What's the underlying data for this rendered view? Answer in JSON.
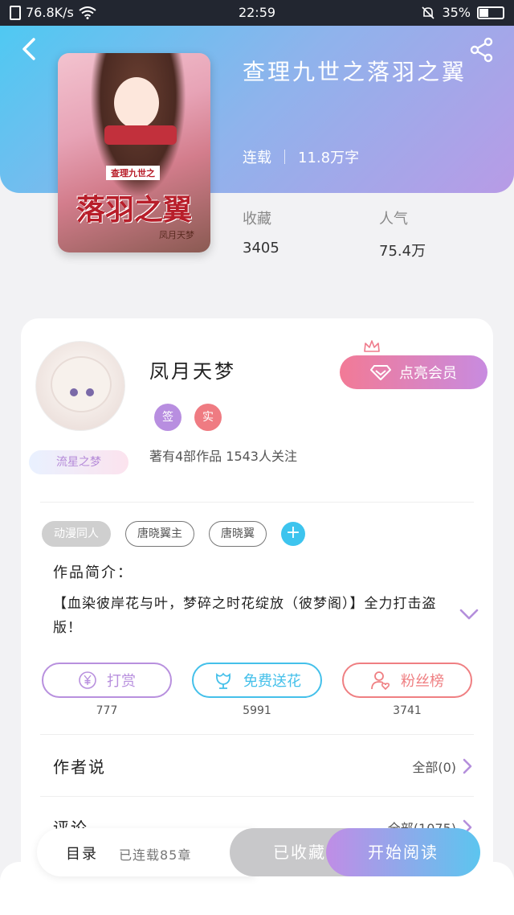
{
  "status_bar": {
    "speed": "76.8K/s",
    "time": "22:59",
    "battery": "35%",
    "battery_level": 0.35
  },
  "book": {
    "title": "查理九世之落羽之翼",
    "status": "连载",
    "word_count": "11.8万字",
    "stats": [
      {
        "label": "收藏",
        "value": "3405"
      },
      {
        "label": "人气",
        "value": "75.4万"
      }
    ],
    "cover": {
      "title_art": "落羽之翼",
      "subtitle_art": "查理九世之",
      "author_art": "凤月天梦"
    }
  },
  "author": {
    "name": "凤月天梦",
    "badges": [
      {
        "label": "签",
        "color": "#b88ee0"
      },
      {
        "label": "实",
        "color": "#ef7b82"
      }
    ],
    "description": "著有4部作品 1543人关注",
    "star_badge": "流星之梦",
    "vip_button": "点亮会员"
  },
  "tags": [
    "动漫同人",
    "唐晓翼主",
    "唐晓翼"
  ],
  "intro": {
    "label": "作品简介：",
    "text": "【血染彼岸花与叶，梦碎之时花绽放（彼梦阁）】全力打击盗版！"
  },
  "actions": [
    {
      "label": "打赏",
      "count": "777",
      "color": "#b890de"
    },
    {
      "label": "免费送花",
      "count": "5991",
      "color": "#44c0ea"
    },
    {
      "label": "粉丝榜",
      "count": "3741",
      "color": "#ef7f82"
    }
  ],
  "sections": [
    {
      "title": "作者说",
      "more": "全部(0)"
    },
    {
      "title": "评论",
      "more": "全部(1075)"
    }
  ],
  "bottom_bar": {
    "toc_label": "目录",
    "chapters": "已连载85章",
    "collected": "已收藏",
    "read": "开始阅读"
  }
}
